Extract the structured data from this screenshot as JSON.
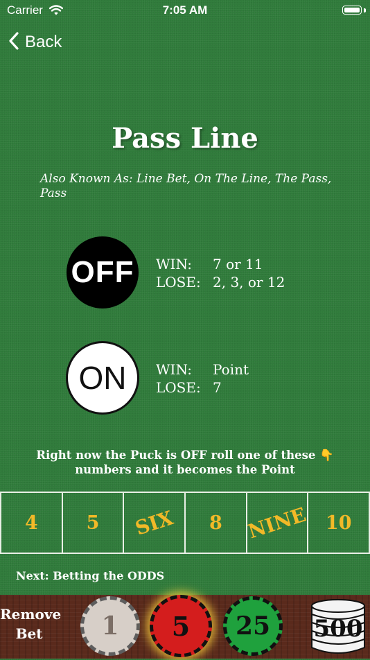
{
  "status_bar": {
    "carrier": "Carrier",
    "time": "7:05 AM"
  },
  "nav": {
    "back_label": "Back"
  },
  "title": "Pass Line",
  "aka": "Also Known As: Line Bet, On The Line, The Pass, Pass",
  "off_puck": {
    "label": "OFF",
    "win_key": "WIN:",
    "win_value": "7 or 11",
    "lose_key": "LOSE:",
    "lose_value": "2, 3, or 12"
  },
  "on_puck": {
    "label": "ON",
    "win_key": "WIN:",
    "win_value": "Point",
    "lose_key": "LOSE:",
    "lose_value": "7"
  },
  "hint": "Right now the Puck is OFF roll one of these 👇 numbers and it becomes the Point",
  "numbers": [
    "4",
    "5",
    "SIX",
    "8",
    "NINE",
    "10"
  ],
  "next_label": "Next: Betting the ODDS",
  "tray": {
    "remove_line1": "Remove",
    "remove_line2": "Bet",
    "chips": [
      "1",
      "5",
      "25",
      "500"
    ],
    "selected_chip": "5"
  },
  "colors": {
    "felt": "#2f7a3a",
    "number_gold": "#f2b928",
    "chip_red": "#d41d1d",
    "chip_green": "#1fa13d"
  }
}
